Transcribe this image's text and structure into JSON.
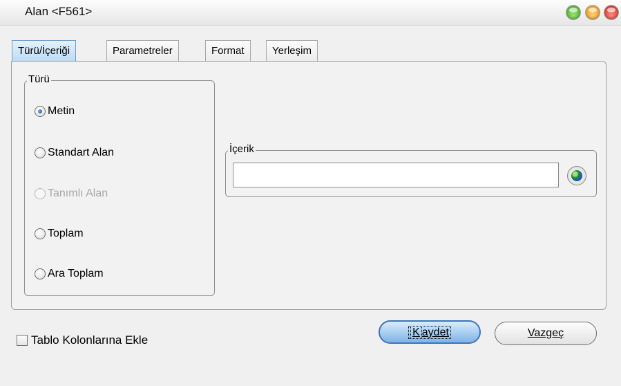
{
  "window": {
    "title": "Alan <F561>"
  },
  "tabs": [
    {
      "label": "Türü/İçeriği",
      "active": true
    },
    {
      "label": "Parametreler",
      "active": false
    },
    {
      "label": "Format",
      "active": false
    },
    {
      "label": "Yerleşim",
      "active": false
    }
  ],
  "type_group": {
    "legend": "Türü",
    "options": [
      {
        "label": "Metin",
        "checked": true,
        "enabled": true
      },
      {
        "label": "Standart Alan",
        "checked": false,
        "enabled": true
      },
      {
        "label": "Tanımlı Alan",
        "checked": false,
        "enabled": false
      },
      {
        "label": "Toplam",
        "checked": false,
        "enabled": true
      },
      {
        "label": "Ara Toplam",
        "checked": false,
        "enabled": true
      }
    ]
  },
  "content_group": {
    "legend": "İçerik",
    "value": ""
  },
  "footer": {
    "checkbox_label": "Tablo Kolonlarına Ekle",
    "checkbox_checked": false,
    "save_label_underlined": "K",
    "save_label_rest": "aydet",
    "cancel_label_underlined": "V",
    "cancel_label_rest": "azgeç"
  },
  "colors": {
    "active_tab": "#bcdcf4",
    "primary_button_border": "#3f74b8"
  },
  "icons": [
    "maximize-circle-icon",
    "minimize-circle-icon",
    "close-circle-icon",
    "globe-icon"
  ]
}
